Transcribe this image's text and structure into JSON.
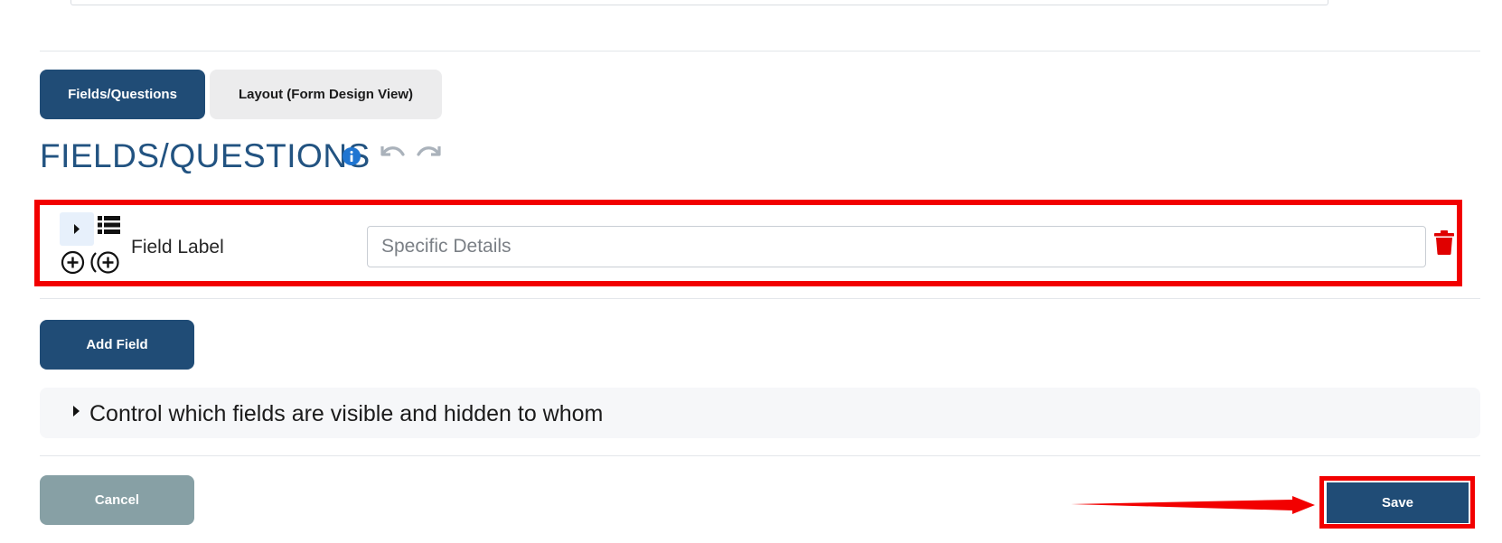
{
  "tabs": [
    {
      "label": "Fields/Questions",
      "active": true
    },
    {
      "label": "Layout (Form Design View)",
      "active": false
    }
  ],
  "section": {
    "title": "FIELDS/QUESTIONS"
  },
  "field_row": {
    "label": "Field Label",
    "input_value": "",
    "input_placeholder": "Specific Details",
    "icons": [
      "caret-right-icon",
      "list-icon",
      "add-circle-icon",
      "add-nested-icon",
      "trash-icon"
    ]
  },
  "actions": {
    "add_field_label": "Add Field",
    "cancel_label": "Cancel",
    "save_label": "Save"
  },
  "visibility_panel": {
    "label": "Control which fields are visible and hidden to whom"
  },
  "colors": {
    "primary": "#204c76",
    "heading": "#225381",
    "cancel": "#87a0a5",
    "highlight": "#f20000",
    "info": "#1f75d1",
    "delete": "#e00000"
  }
}
